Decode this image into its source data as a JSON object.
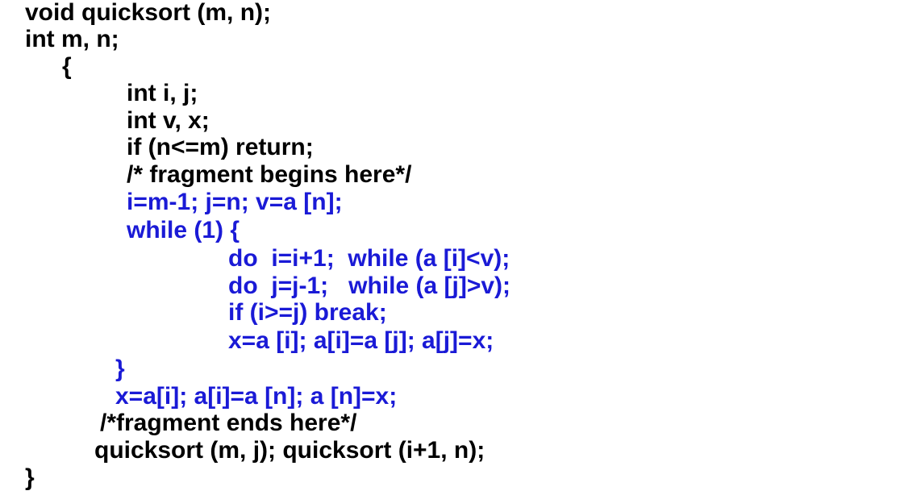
{
  "colors": {
    "plain_text": "#000000",
    "fragment_text": "#1a1ad6"
  },
  "code": {
    "lines": [
      "void quicksort (m, n);",
      "int m, n;",
      "{",
      "int i, j;",
      "int v, x;",
      "if (n<=m) return;",
      "/* fragment begins here*/",
      "i=m-1; j=n; v=a [n];",
      "while (1) {",
      "do  i=i+1;  while (a [i]<v);",
      "do  j=j-1;   while (a [j]>v);",
      "if (i>=j) break;",
      "x=a [i]; a[i]=a [j]; a[j]=x;",
      "}",
      "x=a[i]; a[i]=a [n]; a [n]=x;",
      "/*fragment ends here*/",
      "quicksort (m, j); quicksort (i+1, n);",
      "}"
    ]
  }
}
